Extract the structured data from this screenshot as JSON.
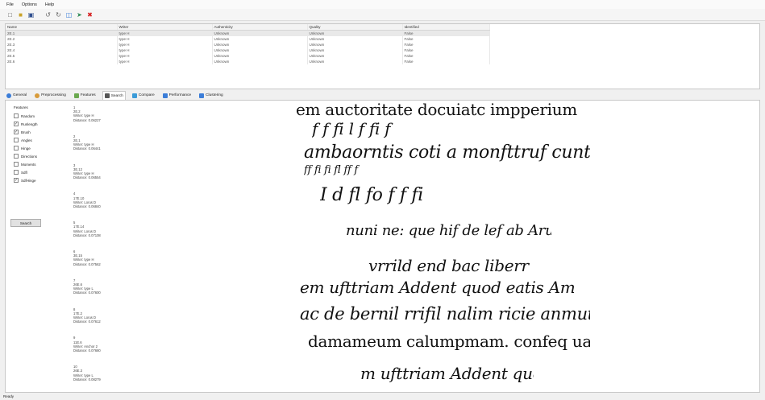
{
  "menu": [
    "File",
    "Options",
    "Help"
  ],
  "toolbar": {
    "icons": [
      "new-icon",
      "open-icon",
      "save-icon",
      "undo-icon",
      "redo-icon",
      "copy-icon",
      "export-icon",
      "delete-icon"
    ]
  },
  "grid": {
    "columns": [
      "Name",
      "Writer",
      "Authenticity",
      "Quality",
      "Identified"
    ],
    "rows": [
      [
        "2E.1",
        "type H",
        "Unknown",
        "Unknown",
        "False"
      ],
      [
        "2E.2",
        "type H",
        "Unknown",
        "Unknown",
        "False"
      ],
      [
        "2E.3",
        "type H",
        "Unknown",
        "Unknown",
        "False"
      ],
      [
        "2E.4",
        "type H",
        "Unknown",
        "Unknown",
        "False"
      ],
      [
        "2E.5",
        "type H",
        "Unknown",
        "Unknown",
        "False"
      ],
      [
        "2E.6",
        "type H",
        "Unknown",
        "Unknown",
        "False"
      ]
    ]
  },
  "tabs": [
    {
      "label": "General",
      "color": "#3b7dd8"
    },
    {
      "label": "Preprocessing",
      "color": "#d89b3b"
    },
    {
      "label": "Features",
      "color": "#6aa84f"
    },
    {
      "label": "Search",
      "color": "#555555"
    },
    {
      "label": "Compare",
      "color": "#3b9bd8"
    },
    {
      "label": "Performance",
      "color": "#3b7dd8"
    },
    {
      "label": "Clustering",
      "color": "#3b7dd8"
    }
  ],
  "features": {
    "title": "Features",
    "items": [
      {
        "label": "Random",
        "checked": false
      },
      {
        "label": "Runlength",
        "checked": true
      },
      {
        "label": "Brush",
        "checked": true
      },
      {
        "label": "Angles",
        "checked": false
      },
      {
        "label": "Hinge",
        "checked": false
      },
      {
        "label": "Directions",
        "checked": false
      },
      {
        "label": "Moments",
        "checked": false
      },
      {
        "label": "Sdfl",
        "checked": false
      },
      {
        "label": "SdfHinge",
        "checked": true
      }
    ],
    "search_label": "Search"
  },
  "results": [
    {
      "rank": "1",
      "name": "2E.2",
      "writer": "Writer: type H",
      "distance": "Distance: 0.06227"
    },
    {
      "rank": "2",
      "name": "2E.1",
      "writer": "Writer: type H",
      "distance": "Distance: 0.06441"
    },
    {
      "rank": "3",
      "name": "3E.12",
      "writer": "Writer: type H",
      "distance": "Distance: 0.06554"
    },
    {
      "rank": "4",
      "name": "17E.10",
      "writer": "Writer: Lorus D",
      "distance": "Distance: 0.06840"
    },
    {
      "rank": "5",
      "name": "17E.14",
      "writer": "Writer: Lorus D",
      "distance": "Distance: 0.07108"
    },
    {
      "rank": "6",
      "name": "3E.15",
      "writer": "Writer: type H",
      "distance": "Distance: 0.07562"
    },
    {
      "rank": "7",
      "name": "26E.6",
      "writer": "Writer: type L",
      "distance": "Distance: 0.07600"
    },
    {
      "rank": "8",
      "name": "17E.2",
      "writer": "Writer: Lorus D",
      "distance": "Distance: 0.07612"
    },
    {
      "rank": "9",
      "name": "11E.6",
      "writer": "Writer: Anchor 2",
      "distance": "Distance: 0.07680"
    },
    {
      "rank": "10",
      "name": "26E.3",
      "writer": "Writer: type L",
      "distance": "Distance: 0.08279"
    }
  ],
  "manuscript": {
    "lines": [
      "em auctoritate docuiatc impperium",
      "f  f  fi  l  f  fi  f",
      "ambaorntis coti a monfttruf cunt. Si quit",
      "ff  fi  fi  fl  ff  f",
      "I  d  fl  fo  f  f  fi",
      "nuni ne: que hif de lef ab Aruflatt:",
      "vrrild end  bac liberr:",
      "em ufttriam  Addent quod eatis Amr",
      "ac de bernil rrifil nalim ricie anmut: Ge",
      "damameum calumpmam. confeq uande t",
      "m ufttriam  Addent quod"
    ]
  },
  "status": "Ready"
}
